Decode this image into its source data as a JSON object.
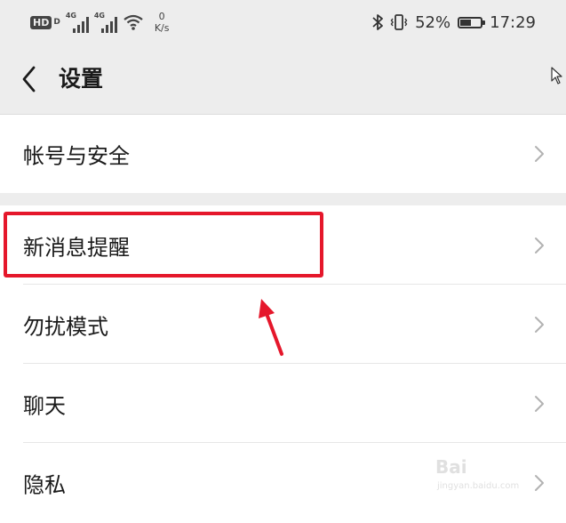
{
  "status_bar": {
    "hd_badge": "HD",
    "hd_sub": "D",
    "network_1": "4G",
    "network_2": "4G",
    "speed_value": "0",
    "speed_unit": "K/s",
    "battery_percent": "52%",
    "battery_level": 0.52,
    "time": "17:29",
    "icons": [
      "hd-icon",
      "signal-icon",
      "signal-icon",
      "wifi-icon",
      "bluetooth-icon",
      "vibrate-icon",
      "battery-icon"
    ]
  },
  "header": {
    "back_icon": "chevron-left-icon",
    "title": "设置"
  },
  "settings": {
    "group1": [
      {
        "label": "帐号与安全"
      }
    ],
    "group2": [
      {
        "label": "新消息提醒"
      },
      {
        "label": "勿扰模式"
      },
      {
        "label": "聊天"
      },
      {
        "label": "隐私"
      }
    ]
  },
  "annotation": {
    "highlight_color": "#e5172b",
    "highlighted_item": "新消息提醒"
  },
  "watermark": {
    "brand": "Bai",
    "sub": "jingyan.baidu.com"
  },
  "colors": {
    "background": "#ededed",
    "card": "#ffffff",
    "text": "#1a1a1a",
    "chevron": "#b2b2b2"
  }
}
